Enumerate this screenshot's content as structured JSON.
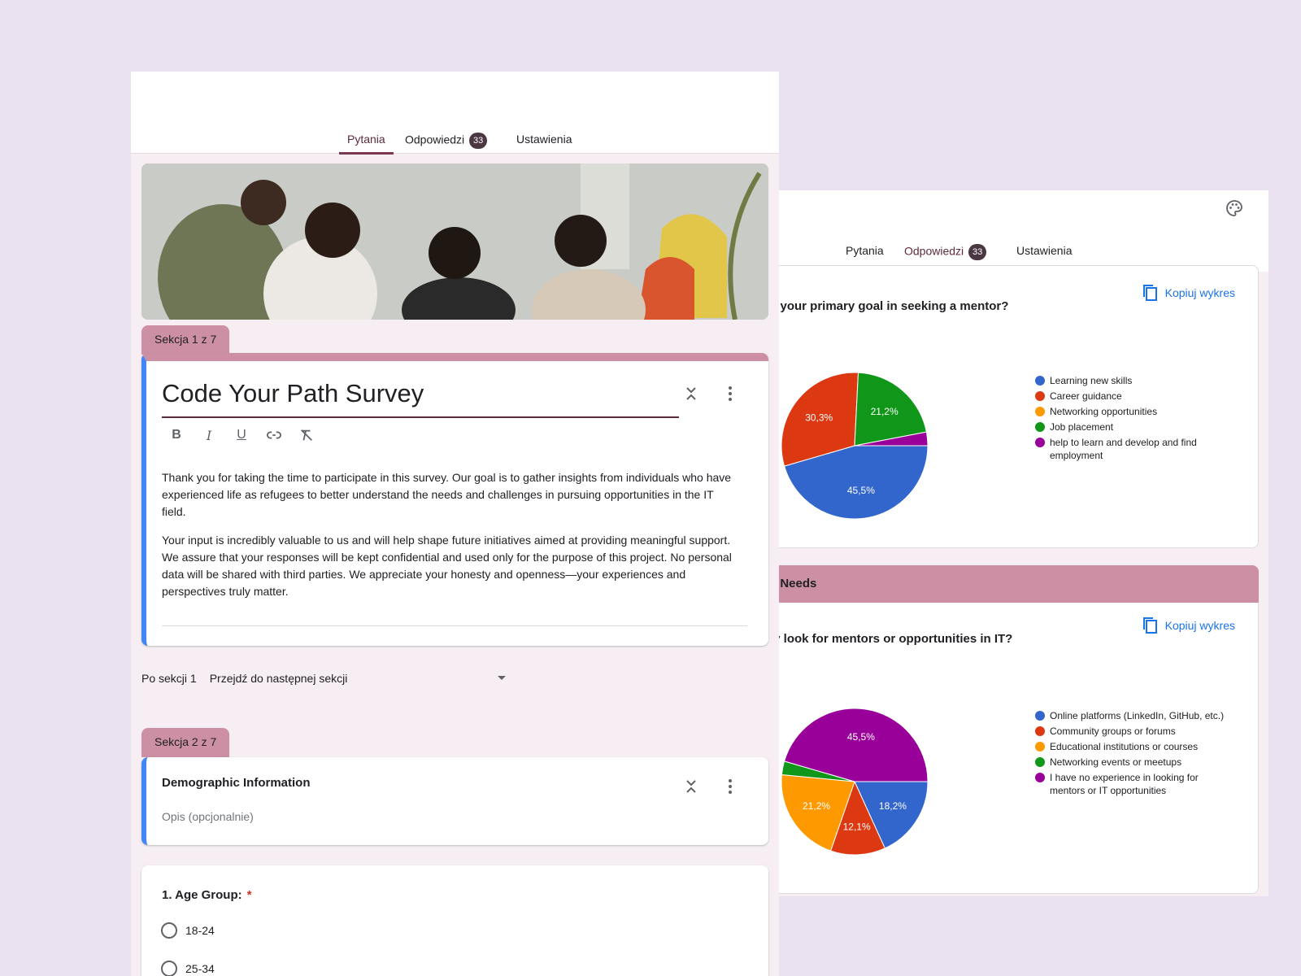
{
  "editor": {
    "tabs": [
      {
        "label": "Pytania"
      },
      {
        "label": "Odpowiedzi",
        "badge": "33"
      },
      {
        "label": "Ustawienia"
      }
    ],
    "section1": {
      "tab": "Sekcja 1 z 7",
      "title": "Code Your Path Survey",
      "paragraphs": [
        "Thank you for taking the time to participate in this survey. Our goal is to gather insights from individuals who have experienced life as refugees to better understand the needs and challenges in pursuing opportunities in the IT field.",
        "Your input is incredibly valuable to us and will help shape future initiatives aimed at providing meaningful support. We assure that your responses will be kept confidential and used only for the purpose of this project. No personal data will be shared with third parties. We appreciate your honesty and openness—your experiences and perspectives truly matter."
      ]
    },
    "after_section": {
      "label": "Po sekcji 1",
      "value": "Przejdź do następnej sekcji"
    },
    "section2": {
      "tab": "Sekcja 2 z 7",
      "title": "Demographic Information",
      "description_placeholder": "Opis (opcjonalnie)"
    },
    "question1": {
      "title": "1. Age Group:",
      "required_mark": "*",
      "options": [
        "18-24",
        "25-34"
      ]
    }
  },
  "responses": {
    "tabs": [
      {
        "label": "Pytania"
      },
      {
        "label": "Odpowiedzi",
        "badge": "33"
      },
      {
        "label": "Ustawienia"
      }
    ],
    "copy_label": "Kopiuj wykres",
    "q_goal_title": "e your primary goal in seeking a mentor?",
    "section_title": "d Needs",
    "q_where_title": "ly look for mentors or opportunities in IT?"
  },
  "colors": {
    "blue": "#3366cc",
    "red": "#dc3912",
    "orange": "#ff9900",
    "green": "#109618",
    "purple": "#990099",
    "section_pink": "#cc8fa3",
    "accent_maroon": "#5a2b3c"
  },
  "chart_data": [
    {
      "type": "pie",
      "title": "e your primary goal in seeking a mentor?",
      "categories": [
        "Learning new skills",
        "Career guidance",
        "Networking opportunities",
        "Job placement",
        "help to learn and develop and find employment"
      ],
      "values": [
        45.5,
        30.3,
        0,
        21.2,
        3.0
      ],
      "labels": [
        "45,5%",
        "30,3%",
        "",
        "21,2%",
        ""
      ],
      "colors": [
        "#3366cc",
        "#dc3912",
        "#ff9900",
        "#109618",
        "#990099"
      ],
      "legend": "right"
    },
    {
      "type": "pie",
      "title": "ly look for mentors or opportunities in IT?",
      "categories": [
        "Online platforms (LinkedIn, GitHub, etc.)",
        "Community groups or forums",
        "Educational institutions or courses",
        "Networking events or meetups",
        "I have no experience in looking for mentors or IT opportunities"
      ],
      "values": [
        18.2,
        12.1,
        21.2,
        3.0,
        45.5
      ],
      "labels": [
        "18,2%",
        "12,1%",
        "21,2%",
        "",
        "45,5%"
      ],
      "colors": [
        "#3366cc",
        "#dc3912",
        "#ff9900",
        "#109618",
        "#990099"
      ],
      "legend": "right"
    }
  ]
}
